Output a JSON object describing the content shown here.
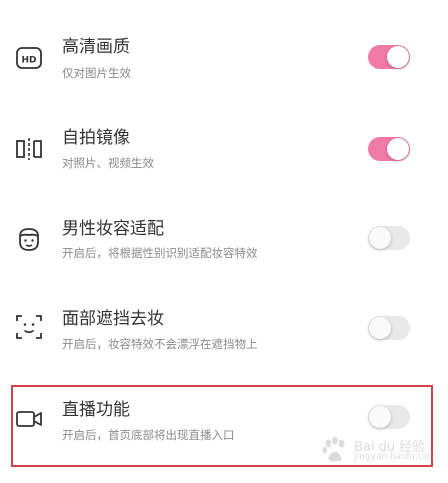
{
  "settings": [
    {
      "title": "高清画质",
      "desc": "仅对图片生效",
      "icon": "hd-icon",
      "state": "on"
    },
    {
      "title": "自拍镜像",
      "desc": "对照片、视频生效",
      "icon": "mirror-icon",
      "state": "on"
    },
    {
      "title": "男性妆容适配",
      "desc": "开启后，将根据性别识别适配妆容特效",
      "icon": "male-face-icon",
      "state": "off"
    },
    {
      "title": "面部遮挡去妆",
      "desc": "开启后，妆容特效不会漂浮在遮挡物上",
      "icon": "face-scan-icon",
      "state": "off"
    },
    {
      "title": "直播功能",
      "desc": "开启后，首页底部将出现直播入口",
      "icon": "video-camera-icon",
      "state": "off"
    }
  ],
  "colors": {
    "toggle_on": "#f07aa6",
    "toggle_off": "#e9e9e9",
    "highlight": "#d0434a"
  },
  "watermark": {
    "text": "Bai du 经验",
    "url": "jingyan.baidu.com"
  }
}
